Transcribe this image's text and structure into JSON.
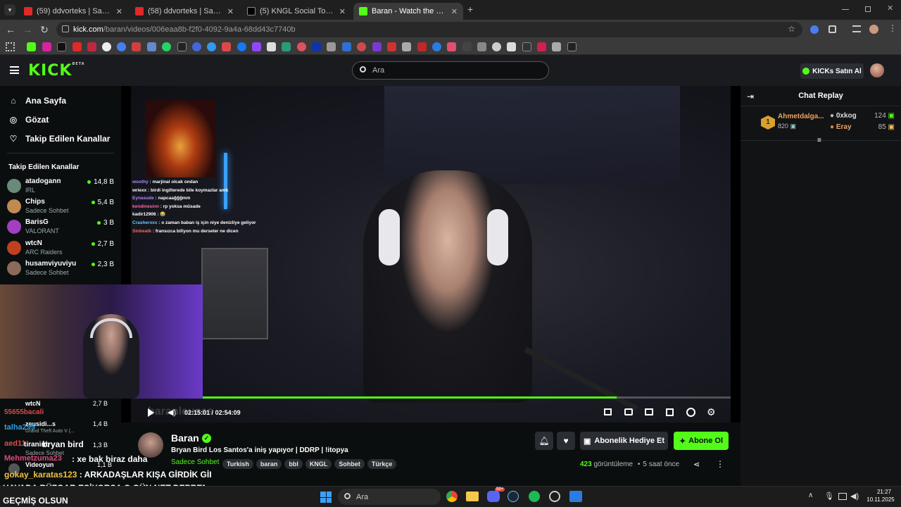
{
  "browser": {
    "tabs": [
      {
        "title": "(59) ddvorteks | Santos Ekspres",
        "favicon_color": "#e02929"
      },
      {
        "title": "(58) ddvorteks | Santos Ekspres",
        "favicon_color": "#e02929"
      },
      {
        "title": "(5) KNGL Social Topluluk / X",
        "favicon_color": "#ffffff"
      },
      {
        "title": "Baran - Watch the VOD on Kick",
        "favicon_color": "#53fc18"
      }
    ],
    "close_glyph": "✕",
    "new_tab_glyph": "+",
    "url_host": "kick.com",
    "url_path": "/baran/videos/006eaa8b-f2f0-4092-9a4a-68dd43c7740b"
  },
  "header": {
    "logo": "KICK",
    "logo_badge": "BETA",
    "search_placeholder": "Ara",
    "kicks_button": "KICKs Satın Al"
  },
  "sidebar": {
    "nav": [
      {
        "label": "Ana Sayfa",
        "icon": "home-icon"
      },
      {
        "label": "Gözat",
        "icon": "compass-icon"
      },
      {
        "label": "Takip Edilen Kanallar",
        "icon": "heart-icon"
      }
    ],
    "following_title": "Takip Edilen Kanallar",
    "channels": [
      {
        "name": "atadogann",
        "category": "IRL",
        "viewers": "14,8 B",
        "color": "#6a8a7a"
      },
      {
        "name": "Chips",
        "category": "Sadece Sohbet",
        "viewers": "5,4 B",
        "color": "#c08a50"
      },
      {
        "name": "BarisG",
        "category": "VALORANT",
        "viewers": "3 B",
        "color": "#a040c0"
      },
      {
        "name": "wtcN",
        "category": "ARC Raiders",
        "viewers": "2,7 B",
        "color": "#c04020"
      },
      {
        "name": "husamviyuviyu",
        "category": "Sadece Sohbet",
        "viewers": "2,3 B",
        "color": "#8a6a5a"
      }
    ]
  },
  "overlay_chat": [
    {
      "user": "woothy",
      "msg": "marjinal olcak ondan",
      "color": "#b088ff"
    },
    {
      "user": "wriexx",
      "msg": "birdi ingilterede bile koymazlar amk",
      "color": "#ffffff"
    },
    {
      "user": "Eynasude",
      "msg": "napcaağğğmm",
      "color": "#b088ff"
    },
    {
      "user": "kendinesinn",
      "msg": "rp yoksa müsade",
      "color": "#ff66aa"
    },
    {
      "user": "kadir12906",
      "msg": "😂",
      "color": "#ffffff"
    },
    {
      "user": "Crasherxxx",
      "msg": "o zaman baban iş için niye denizliye geliyor",
      "color": "#66ccff"
    },
    {
      "user": "Sinbeatk",
      "msg": "fransızca biliyon mu derseler ne dicen",
      "color": "#ff6666"
    }
  ],
  "player": {
    "time_current": "02:15:01",
    "time_separator": "/",
    "time_total": "02:54:09",
    "progress": 0.81,
    "watermark": "baranleusss"
  },
  "chat": {
    "title": "Chat Replay",
    "leaderboard": [
      {
        "rank": "1",
        "name": "Ahmetdalga...",
        "value": "820"
      },
      {
        "name": "0xkog",
        "value": "124"
      },
      {
        "name": "Eray",
        "value": "85"
      }
    ]
  },
  "stream": {
    "streamer": "Baran",
    "title": "Bryan Bird Los Santos'a iniş yapıyor | DDRP | !itopya",
    "category": "Sadece Sohbet",
    "tags": [
      "Turkish",
      "baran",
      "bbl",
      "KNGL",
      "Sohbet",
      "Türkçe"
    ],
    "gift_button": "Abonelik Hediye Et",
    "subscribe_button": "Abone Ol",
    "views_count": "423",
    "views_label": "görüntüleme",
    "time_ago": "5 saat önce"
  },
  "overlay_bottom": {
    "side_names": [
      {
        "name": "wtcN",
        "viewers": "2,7 B"
      },
      {
        "name": "zeusidi...s",
        "sub": "Grand Theft Auto V (...",
        "viewers": "1,4 B"
      },
      {
        "name": "bryan bird",
        "sub": "Sadece Sohbet",
        "viewers": "1,3 B"
      },
      {
        "name": "Videoyun",
        "viewers": "1,1 B"
      }
    ],
    "fragments": [
      "55655bacali",
      "talha299",
      "aed11",
      "tiraninb",
      "Mehmetzuma23",
      "gokay_karatas123"
    ],
    "line1_msg": ": xe bak biraz daha",
    "line2": "ARKADAŞLAR KIŞA GİRDİK GİI",
    "line3": "HAVADA RÜZGAR ESİYORSA O GÜN NET DEPREM",
    "line4": "GEÇMİŞ OLSUN"
  },
  "taskbar": {
    "search": "Ara",
    "time": "21:27",
    "date": "10.11.2025",
    "badge": "99+"
  }
}
